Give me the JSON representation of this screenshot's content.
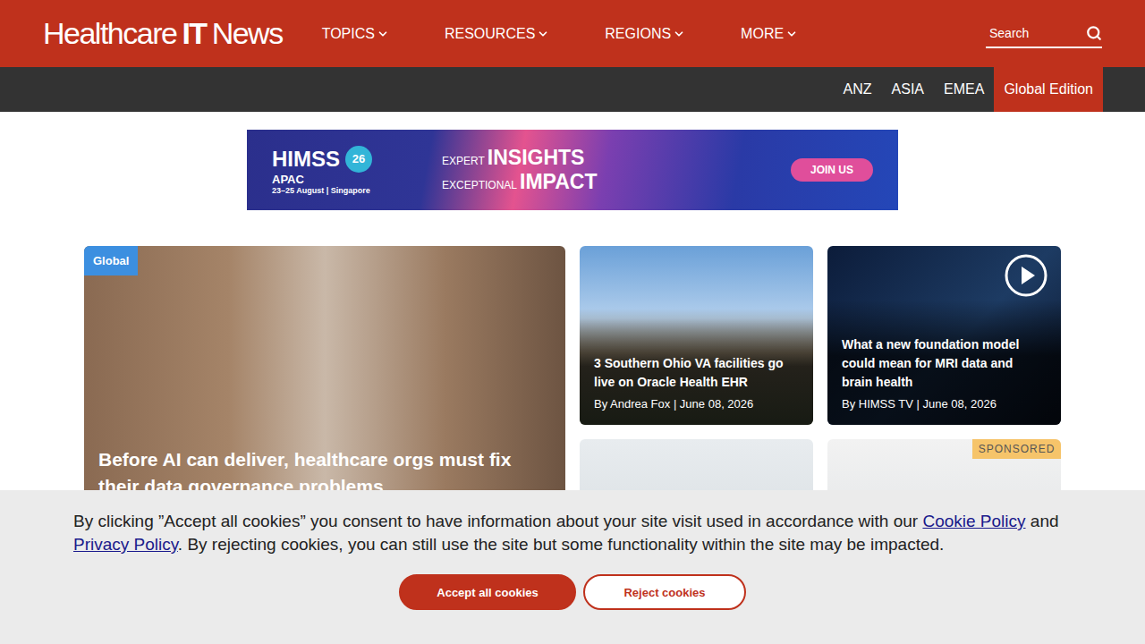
{
  "header": {
    "logo": {
      "before": "Healthcare",
      "bold": "IT",
      "after": "News"
    },
    "nav": [
      "TOPICS",
      "RESOURCES",
      "REGIONS",
      "MORE"
    ],
    "search": {
      "placeholder": "Search"
    }
  },
  "editions": [
    {
      "label": "ANZ",
      "selected": false
    },
    {
      "label": "ASIA",
      "selected": false
    },
    {
      "label": "EMEA",
      "selected": false
    },
    {
      "label": "Global Edition",
      "selected": true
    }
  ],
  "banner": {
    "brand": "HIMSS",
    "edition": "26",
    "region": "APAC",
    "when": "23–25 August | Singapore",
    "line1_small": "EXPERT",
    "line1_big": "INSIGHTS",
    "line2_small": "EXCEPTIONAL",
    "line2_big": "IMPACT",
    "button": "JOIN US"
  },
  "cards": [
    {
      "kind": "feature",
      "tag": "Global",
      "title": "Before AI can deliver, healthcare orgs must fix their data governance problems"
    },
    {
      "kind": "story",
      "title": "3 Southern Ohio VA facilities go live on Oracle Health EHR",
      "byline": "By Andrea Fox | June 08, 2026"
    },
    {
      "kind": "video",
      "title": "What a new foundation model could mean for MRI data and brain health",
      "byline": "By HIMSS TV | June 08, 2026"
    },
    {
      "kind": "photo"
    },
    {
      "kind": "sponsored",
      "badge": "SPONSORED"
    }
  ],
  "cookie": {
    "before": "By clicking ”Accept all cookies” you consent to have information about your site visit used in accordance with our ",
    "link1": "Cookie Policy",
    "between": " and ",
    "link2": "Privacy Policy",
    "after": ". By rejecting cookies, you can still use the site but some functionality within the site may be impacted.",
    "accept": "Accept all cookies",
    "reject": "Reject cookies"
  }
}
